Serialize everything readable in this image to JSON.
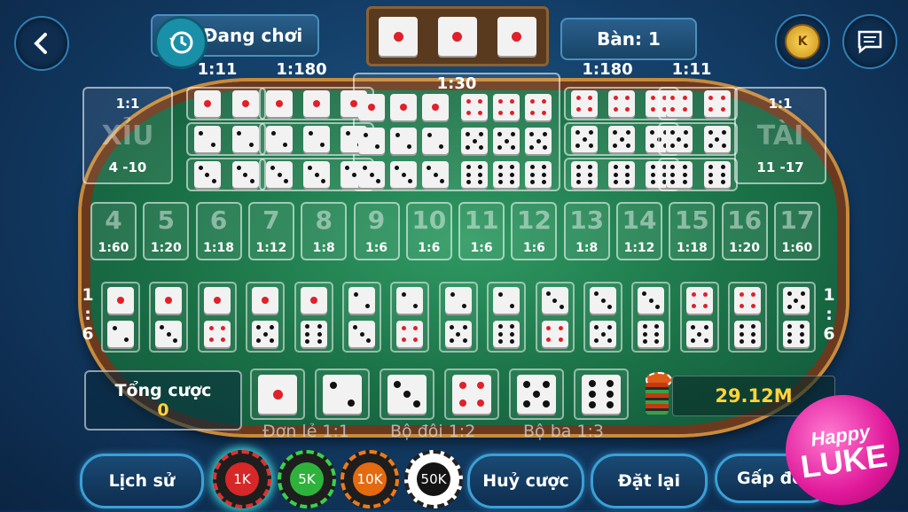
{
  "header": {
    "tab_label": "Đang chơi",
    "table_label": "Bàn: 1",
    "top_dice": [
      1,
      1,
      1
    ]
  },
  "ratios": {
    "double_left": "1:11",
    "triple_left": "1:180",
    "any_triple": "1:30",
    "triple_right": "1:180",
    "double_right": "1:11"
  },
  "xiu": {
    "odds": "1:1",
    "name": "XỈU",
    "range": "4 -10"
  },
  "tai": {
    "odds": "1:1",
    "name": "TÀI",
    "range": "11 -17"
  },
  "sums": [
    {
      "n": "4",
      "o": "1:60"
    },
    {
      "n": "5",
      "o": "1:20"
    },
    {
      "n": "6",
      "o": "1:18"
    },
    {
      "n": "7",
      "o": "1:12"
    },
    {
      "n": "8",
      "o": "1:8"
    },
    {
      "n": "9",
      "o": "1:6"
    },
    {
      "n": "10",
      "o": "1:6"
    },
    {
      "n": "11",
      "o": "1:6"
    },
    {
      "n": "12",
      "o": "1:6"
    },
    {
      "n": "13",
      "o": "1:8"
    },
    {
      "n": "14",
      "o": "1:12"
    },
    {
      "n": "15",
      "o": "1:18"
    },
    {
      "n": "16",
      "o": "1:20"
    },
    {
      "n": "17",
      "o": "1:60"
    }
  ],
  "combo_odds": {
    "left": "1\n:\n6",
    "right": "1\n:\n6",
    "l1": "1",
    "l2": ":",
    "l3": "6"
  },
  "combos": [
    [
      1,
      2
    ],
    [
      1,
      3
    ],
    [
      1,
      4
    ],
    [
      1,
      5
    ],
    [
      1,
      6
    ],
    [
      2,
      3
    ],
    [
      2,
      4
    ],
    [
      2,
      5
    ],
    [
      2,
      6
    ],
    [
      3,
      4
    ],
    [
      3,
      5
    ],
    [
      3,
      6
    ],
    [
      4,
      5
    ],
    [
      4,
      6
    ],
    [
      5,
      6
    ]
  ],
  "total_bet": {
    "label": "Tổng cược",
    "value": "0"
  },
  "single_dice": [
    1,
    2,
    3,
    4,
    5,
    6
  ],
  "balance": "29.12M",
  "payouts": {
    "single": "Đơn lẻ 1:1",
    "double": "Bộ đôi 1:2",
    "triple": "Bộ ba 1:3"
  },
  "chips": [
    "1K",
    "5K",
    "10K",
    "50K"
  ],
  "buttons": {
    "history": "Lịch sử",
    "cancel": "Huỷ cược",
    "reset": "Đặt lại",
    "double": "Gấp đôi"
  },
  "logo": {
    "line1": "Happy",
    "line2": "LUKE"
  },
  "coin_letter": "K",
  "colors": {
    "red_pip": "#e0202a",
    "black_pip": "#111111",
    "gold": "#ffd43a"
  }
}
